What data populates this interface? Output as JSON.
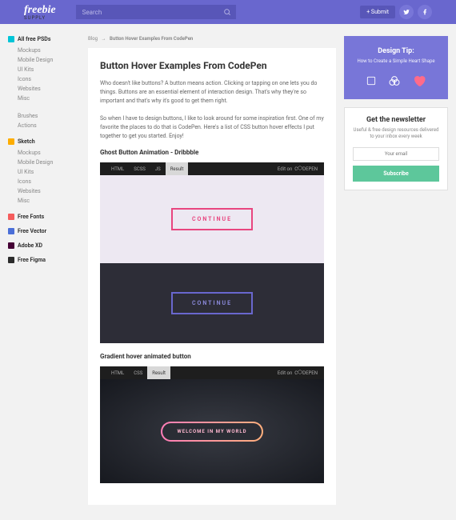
{
  "topbar": {
    "logo": "freebie",
    "logo_sub": "SUPPLY",
    "search_placeholder": "Search",
    "submit_label": "+ Submit"
  },
  "sidebar": {
    "sections": [
      {
        "icon_color": "#00c5d7",
        "head": "All free PSDs",
        "items": [
          "Mockups",
          "Mobile Design",
          "UI Kits",
          "Icons",
          "Websites",
          "Misc"
        ]
      },
      {
        "icon_color": "",
        "head": "",
        "items": [
          "Brushes",
          "Actions"
        ]
      },
      {
        "icon_color": "#fdad00",
        "head": "Sketch",
        "items": [
          "Mockups",
          "Mobile Design",
          "UI Kits",
          "Icons",
          "Websites",
          "Misc"
        ]
      },
      {
        "icon_color": "#f55d5d",
        "head": "Free Fonts",
        "items": []
      },
      {
        "icon_color": "#4b6fd8",
        "head": "Free Vector",
        "items": []
      },
      {
        "icon_color": "#450135",
        "head": "Adobe XD",
        "items": []
      },
      {
        "icon_color": "#2c2c2c",
        "head": "Free Figma",
        "items": []
      }
    ]
  },
  "crumb": {
    "root": "Blog",
    "current": "Button Hover Examples From CodePen"
  },
  "article": {
    "title": "Button Hover Examples From CodePen",
    "p1": "Who doesn't like buttons? A button means action. Clicking or tapping on one lets you do things. Buttons are an essential element of interaction design. That's why they're so important and that's why it's good to get them right.",
    "p2": "So when I have to design buttons, I like to look around for some inspiration first. One of my favorite the places to do that is CodePen. Here's a list of CSS button hover effects I put together to get you started. Enjoy!",
    "sub1": "Ghost Button Animation - Dribbble",
    "sub2": "Gradient hover animated button"
  },
  "pen1": {
    "tabs": [
      "HTML",
      "SCSS",
      "JS",
      "Result"
    ],
    "active": 3,
    "edit": "Edit on",
    "btn1": "CONTINUE",
    "btn2": "CONTINUE"
  },
  "pen2": {
    "tabs": [
      "HTML",
      "CSS",
      "Result"
    ],
    "active": 2,
    "edit": "Edit on",
    "btn": "WELCOME IN MY WORLD"
  },
  "aside": {
    "tip_title": "Design Tip:",
    "tip_sub": "How to Create a Simple Heart Shape",
    "nl_title": "Get the newsletter",
    "nl_desc": "Useful & free design resources delivered to your inbox every week",
    "nl_placeholder": "Your email",
    "nl_btn": "Subscribe"
  }
}
